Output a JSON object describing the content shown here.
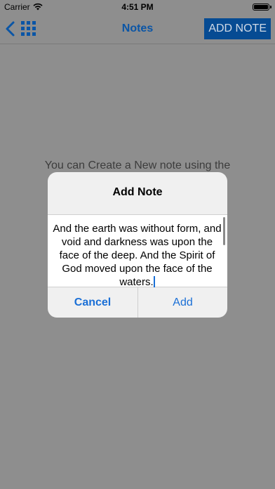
{
  "status_bar": {
    "carrier": "Carrier",
    "time": "4:51 PM"
  },
  "navbar": {
    "title": "Notes",
    "add_note_label": "ADD NOTE",
    "back_icon": "chevron-left-icon",
    "grid_icon": "grid-icon"
  },
  "main": {
    "empty_hint": "You can Create a New note using the"
  },
  "dialog": {
    "title": "Add Note",
    "text_value": "And the earth was without form, and void and darkness was upon the face of the deep. And the Spirit of God moved upon the face of the waters.",
    "cancel_label": "Cancel",
    "add_label": "Add"
  },
  "colors": {
    "accent": "#1a6fd6",
    "nav_title": "#0a55a6",
    "add_note_bg": "#064b93",
    "overlay": "#8e8e8e"
  }
}
